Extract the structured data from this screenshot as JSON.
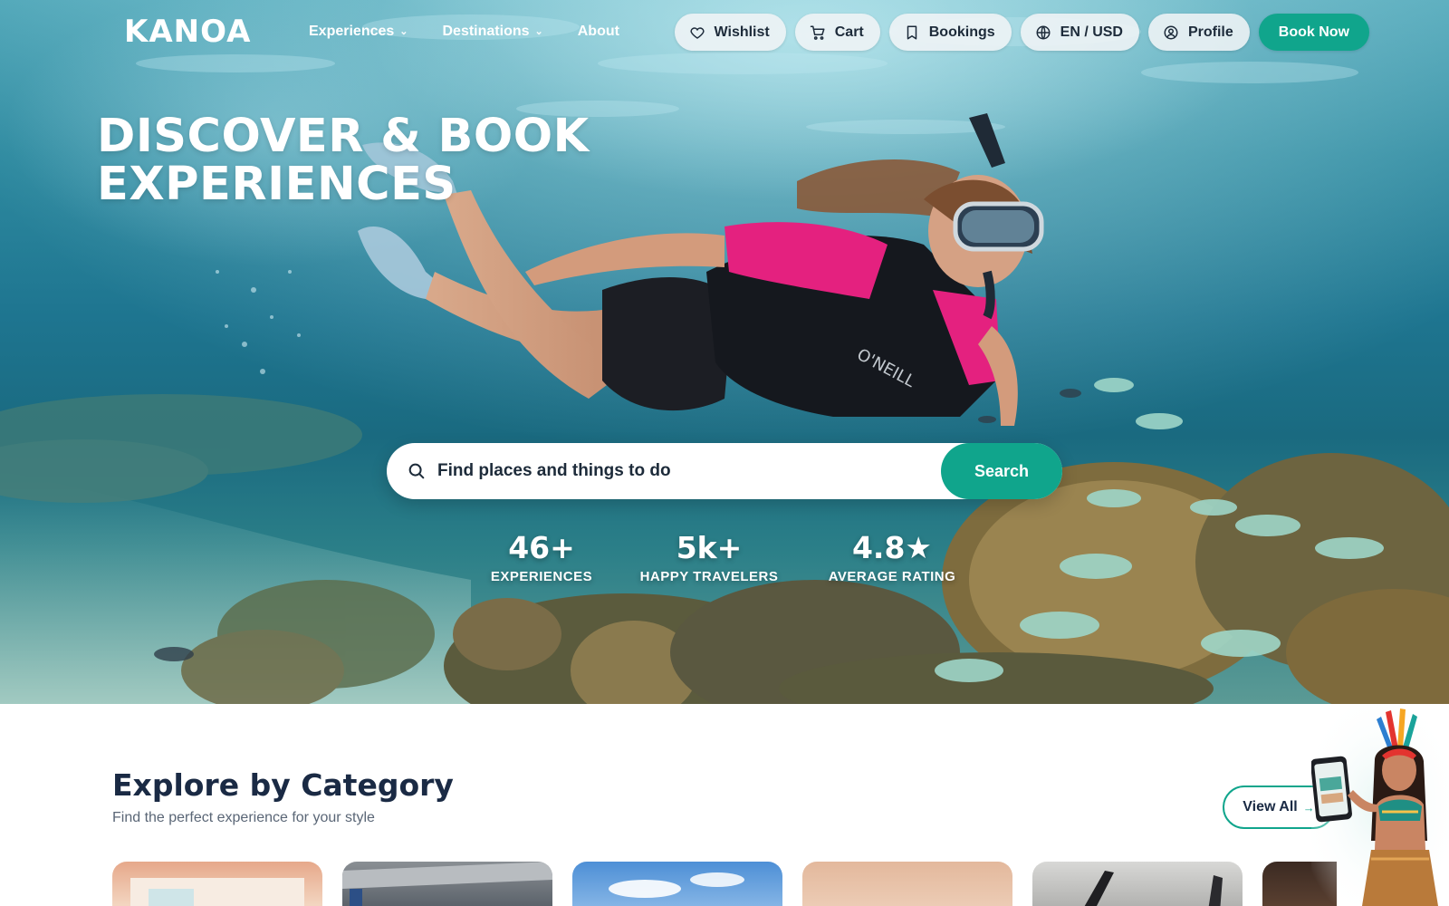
{
  "brand": {
    "logo_text": "KANOA"
  },
  "nav": {
    "links": [
      {
        "label": "Experiences",
        "has_dropdown": true
      },
      {
        "label": "Destinations",
        "has_dropdown": true
      },
      {
        "label": "About",
        "has_dropdown": false
      }
    ],
    "pills": [
      {
        "label": "Wishlist",
        "icon": "heart-icon"
      },
      {
        "label": "Cart",
        "icon": "cart-icon"
      },
      {
        "label": "Bookings",
        "icon": "bookmark-icon"
      },
      {
        "label": "EN / USD",
        "icon": "globe-icon"
      },
      {
        "label": "Profile",
        "icon": "user-circle-icon"
      }
    ],
    "cta_label": "Book Now"
  },
  "hero": {
    "title_line1": "DISCOVER & BOOK",
    "title_line2": "EXPERIENCES",
    "search": {
      "placeholder": "Find places and things to do",
      "button_label": "Search"
    },
    "stats": [
      {
        "value": "46+",
        "label": "EXPERIENCES"
      },
      {
        "value": "5k+",
        "label": "HAPPY TRAVELERS"
      },
      {
        "value": "4.8★",
        "label": "AVERAGE RATING"
      }
    ]
  },
  "category_section": {
    "title": "Explore by Category",
    "subtitle": "Find the perfect experience for your style",
    "view_all_label": "View All",
    "view_all_arrow": "→"
  },
  "colors": {
    "accent": "#10a58c",
    "heading": "#1a2a44",
    "muted": "#5a6676",
    "pill_bg": "#f0f4f6"
  }
}
